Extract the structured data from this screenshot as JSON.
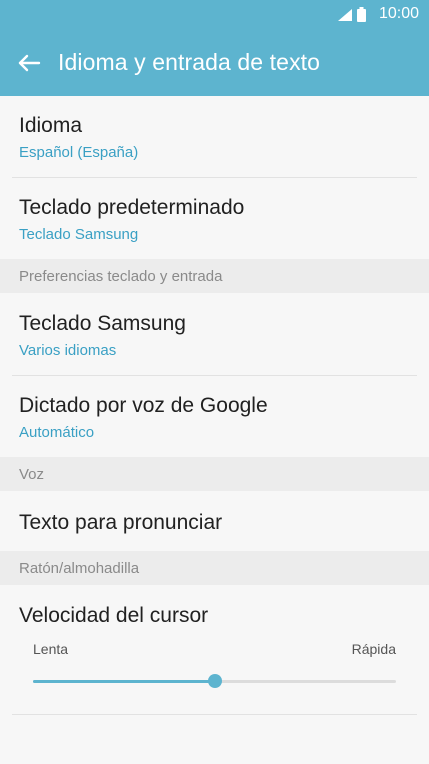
{
  "status_bar": {
    "time": "10:00",
    "icons": [
      "signal-icon",
      "battery-icon"
    ]
  },
  "header": {
    "back_icon": "arrow-left-icon",
    "title": "Idioma y entrada de texto"
  },
  "items": {
    "language": {
      "title": "Idioma",
      "subtitle": "Español (España)"
    },
    "default_keyboard": {
      "title": "Teclado predeterminado",
      "subtitle": "Teclado Samsung"
    },
    "samsung_keyboard": {
      "title": "Teclado Samsung",
      "subtitle": "Varios idiomas"
    },
    "google_voice": {
      "title": "Dictado por voz de Google",
      "subtitle": "Automático"
    },
    "tts": {
      "title": "Texto para pronunciar"
    }
  },
  "sections": {
    "keyboard_prefs": "Preferencias teclado y entrada",
    "voice": "Voz",
    "mouse": "Ratón/almohadilla"
  },
  "cursor_speed": {
    "title": "Velocidad del cursor",
    "min_label": "Lenta",
    "max_label": "Rápida",
    "value_fraction": 0.5
  },
  "colors": {
    "accent": "#5db4cf",
    "subtitle": "#3aa0c4",
    "section_bg": "#ececec",
    "background": "#f7f7f7"
  }
}
